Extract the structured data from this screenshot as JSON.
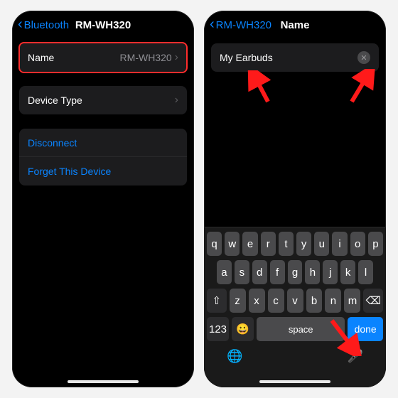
{
  "left": {
    "back_label": "Bluetooth",
    "title": "RM-WH320",
    "name_row": {
      "label": "Name",
      "value": "RM-WH320"
    },
    "device_type_label": "Device Type",
    "disconnect_label": "Disconnect",
    "forget_label": "Forget This Device"
  },
  "right": {
    "back_label": "RM-WH320",
    "title": "Name",
    "input_value": "My Earbuds",
    "keyboard": {
      "row1": [
        "q",
        "w",
        "e",
        "r",
        "t",
        "y",
        "u",
        "i",
        "o",
        "p"
      ],
      "row2": [
        "a",
        "s",
        "d",
        "f",
        "g",
        "h",
        "j",
        "k",
        "l"
      ],
      "row3_mid": [
        "z",
        "x",
        "c",
        "v",
        "b",
        "n",
        "m"
      ],
      "num_key": "123",
      "emoji_key": "😀",
      "space_label": "space",
      "done_label": "done",
      "shift_glyph": "⇧",
      "del_glyph": "⌫",
      "globe_glyph": "🌐",
      "mic_glyph": "🎤"
    }
  }
}
